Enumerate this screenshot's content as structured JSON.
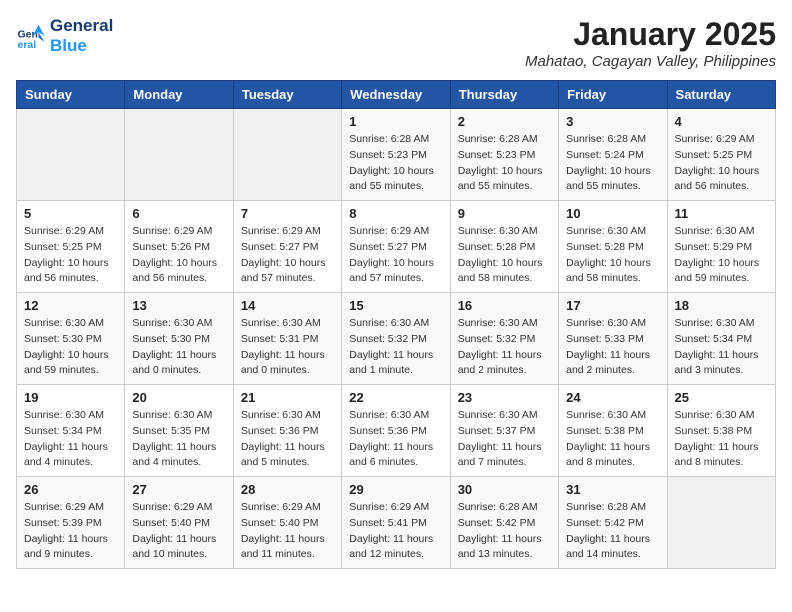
{
  "logo": {
    "line1": "General",
    "line2": "Blue"
  },
  "title": "January 2025",
  "location": "Mahatao, Cagayan Valley, Philippines",
  "weekdays": [
    "Sunday",
    "Monday",
    "Tuesday",
    "Wednesday",
    "Thursday",
    "Friday",
    "Saturday"
  ],
  "weeks": [
    [
      {
        "day": "",
        "info": ""
      },
      {
        "day": "",
        "info": ""
      },
      {
        "day": "",
        "info": ""
      },
      {
        "day": "1",
        "info": "Sunrise: 6:28 AM\nSunset: 5:23 PM\nDaylight: 10 hours\nand 55 minutes."
      },
      {
        "day": "2",
        "info": "Sunrise: 6:28 AM\nSunset: 5:23 PM\nDaylight: 10 hours\nand 55 minutes."
      },
      {
        "day": "3",
        "info": "Sunrise: 6:28 AM\nSunset: 5:24 PM\nDaylight: 10 hours\nand 55 minutes."
      },
      {
        "day": "4",
        "info": "Sunrise: 6:29 AM\nSunset: 5:25 PM\nDaylight: 10 hours\nand 56 minutes."
      }
    ],
    [
      {
        "day": "5",
        "info": "Sunrise: 6:29 AM\nSunset: 5:25 PM\nDaylight: 10 hours\nand 56 minutes."
      },
      {
        "day": "6",
        "info": "Sunrise: 6:29 AM\nSunset: 5:26 PM\nDaylight: 10 hours\nand 56 minutes."
      },
      {
        "day": "7",
        "info": "Sunrise: 6:29 AM\nSunset: 5:27 PM\nDaylight: 10 hours\nand 57 minutes."
      },
      {
        "day": "8",
        "info": "Sunrise: 6:29 AM\nSunset: 5:27 PM\nDaylight: 10 hours\nand 57 minutes."
      },
      {
        "day": "9",
        "info": "Sunrise: 6:30 AM\nSunset: 5:28 PM\nDaylight: 10 hours\nand 58 minutes."
      },
      {
        "day": "10",
        "info": "Sunrise: 6:30 AM\nSunset: 5:28 PM\nDaylight: 10 hours\nand 58 minutes."
      },
      {
        "day": "11",
        "info": "Sunrise: 6:30 AM\nSunset: 5:29 PM\nDaylight: 10 hours\nand 59 minutes."
      }
    ],
    [
      {
        "day": "12",
        "info": "Sunrise: 6:30 AM\nSunset: 5:30 PM\nDaylight: 10 hours\nand 59 minutes."
      },
      {
        "day": "13",
        "info": "Sunrise: 6:30 AM\nSunset: 5:30 PM\nDaylight: 11 hours\nand 0 minutes."
      },
      {
        "day": "14",
        "info": "Sunrise: 6:30 AM\nSunset: 5:31 PM\nDaylight: 11 hours\nand 0 minutes."
      },
      {
        "day": "15",
        "info": "Sunrise: 6:30 AM\nSunset: 5:32 PM\nDaylight: 11 hours\nand 1 minute."
      },
      {
        "day": "16",
        "info": "Sunrise: 6:30 AM\nSunset: 5:32 PM\nDaylight: 11 hours\nand 2 minutes."
      },
      {
        "day": "17",
        "info": "Sunrise: 6:30 AM\nSunset: 5:33 PM\nDaylight: 11 hours\nand 2 minutes."
      },
      {
        "day": "18",
        "info": "Sunrise: 6:30 AM\nSunset: 5:34 PM\nDaylight: 11 hours\nand 3 minutes."
      }
    ],
    [
      {
        "day": "19",
        "info": "Sunrise: 6:30 AM\nSunset: 5:34 PM\nDaylight: 11 hours\nand 4 minutes."
      },
      {
        "day": "20",
        "info": "Sunrise: 6:30 AM\nSunset: 5:35 PM\nDaylight: 11 hours\nand 4 minutes."
      },
      {
        "day": "21",
        "info": "Sunrise: 6:30 AM\nSunset: 5:36 PM\nDaylight: 11 hours\nand 5 minutes."
      },
      {
        "day": "22",
        "info": "Sunrise: 6:30 AM\nSunset: 5:36 PM\nDaylight: 11 hours\nand 6 minutes."
      },
      {
        "day": "23",
        "info": "Sunrise: 6:30 AM\nSunset: 5:37 PM\nDaylight: 11 hours\nand 7 minutes."
      },
      {
        "day": "24",
        "info": "Sunrise: 6:30 AM\nSunset: 5:38 PM\nDaylight: 11 hours\nand 8 minutes."
      },
      {
        "day": "25",
        "info": "Sunrise: 6:30 AM\nSunset: 5:38 PM\nDaylight: 11 hours\nand 8 minutes."
      }
    ],
    [
      {
        "day": "26",
        "info": "Sunrise: 6:29 AM\nSunset: 5:39 PM\nDaylight: 11 hours\nand 9 minutes."
      },
      {
        "day": "27",
        "info": "Sunrise: 6:29 AM\nSunset: 5:40 PM\nDaylight: 11 hours\nand 10 minutes."
      },
      {
        "day": "28",
        "info": "Sunrise: 6:29 AM\nSunset: 5:40 PM\nDaylight: 11 hours\nand 11 minutes."
      },
      {
        "day": "29",
        "info": "Sunrise: 6:29 AM\nSunset: 5:41 PM\nDaylight: 11 hours\nand 12 minutes."
      },
      {
        "day": "30",
        "info": "Sunrise: 6:28 AM\nSunset: 5:42 PM\nDaylight: 11 hours\nand 13 minutes."
      },
      {
        "day": "31",
        "info": "Sunrise: 6:28 AM\nSunset: 5:42 PM\nDaylight: 11 hours\nand 14 minutes."
      },
      {
        "day": "",
        "info": ""
      }
    ]
  ]
}
